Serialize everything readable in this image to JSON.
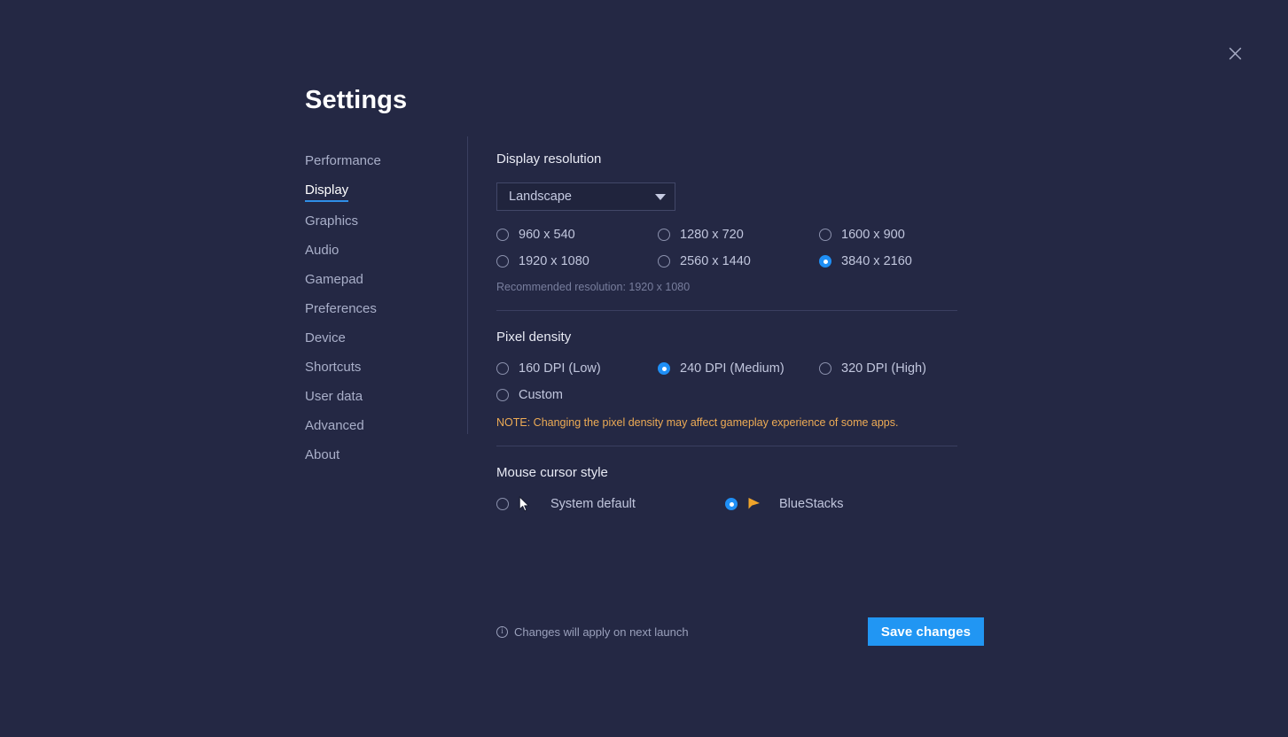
{
  "window": {
    "title": "Settings",
    "close_icon": "close-icon"
  },
  "colors": {
    "background": "#242844",
    "accent_blue": "#2196f3",
    "radio_selected": "#1f8ff5",
    "note_orange": "#edab55",
    "divider": "#3a3f60",
    "bluestacks_cursor": "#f0a42a"
  },
  "sidebar": {
    "items": [
      {
        "label": "Performance",
        "active": false
      },
      {
        "label": "Display",
        "active": true
      },
      {
        "label": "Graphics",
        "active": false
      },
      {
        "label": "Audio",
        "active": false
      },
      {
        "label": "Gamepad",
        "active": false
      },
      {
        "label": "Preferences",
        "active": false
      },
      {
        "label": "Device",
        "active": false
      },
      {
        "label": "Shortcuts",
        "active": false
      },
      {
        "label": "User data",
        "active": false
      },
      {
        "label": "Advanced",
        "active": false
      },
      {
        "label": "About",
        "active": false
      }
    ]
  },
  "display_resolution": {
    "title": "Display resolution",
    "orientation_dropdown": {
      "selected": "Landscape",
      "caret_icon": "chevron-down-icon"
    },
    "options": [
      {
        "label": "960 x 540",
        "selected": false
      },
      {
        "label": "1280 x 720",
        "selected": false
      },
      {
        "label": "1600 x 900",
        "selected": false
      },
      {
        "label": "1920 x 1080",
        "selected": false
      },
      {
        "label": "2560 x 1440",
        "selected": false
      },
      {
        "label": "3840 x 2160",
        "selected": true
      }
    ],
    "recommended": "Recommended resolution: 1920 x 1080"
  },
  "pixel_density": {
    "title": "Pixel density",
    "options": [
      {
        "label": "160 DPI (Low)",
        "selected": false
      },
      {
        "label": "240 DPI (Medium)",
        "selected": true
      },
      {
        "label": "320 DPI (High)",
        "selected": false
      },
      {
        "label": "Custom",
        "selected": false
      }
    ],
    "note": "NOTE: Changing the pixel density may affect gameplay experience of some apps."
  },
  "mouse_cursor_style": {
    "title": "Mouse cursor style",
    "options": [
      {
        "label": "System default",
        "selected": false,
        "icon": "system-cursor-icon"
      },
      {
        "label": "BlueStacks",
        "selected": true,
        "icon": "bluestacks-cursor-icon"
      }
    ]
  },
  "footer": {
    "info_icon": "info-icon",
    "note": "Changes will apply on next launch",
    "save_label": "Save changes"
  }
}
